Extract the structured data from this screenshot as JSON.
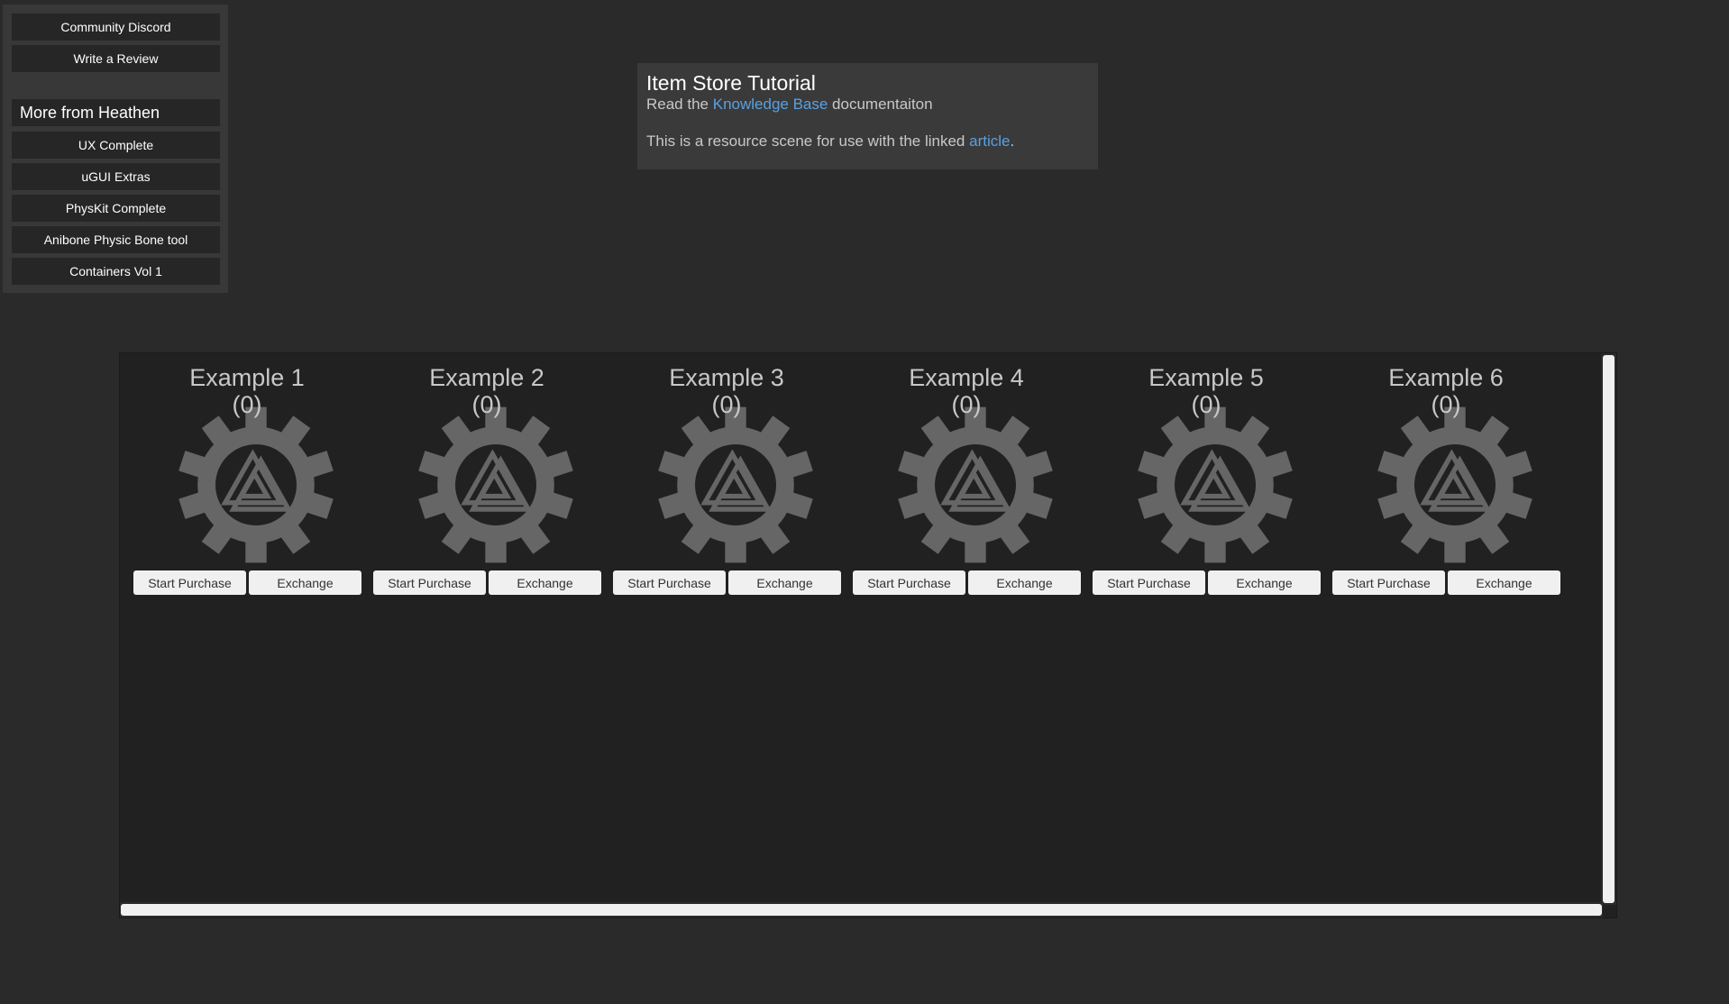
{
  "sidebar": {
    "top_buttons": [
      "Community Discord",
      "Write a Review"
    ],
    "header": "More from Heathen",
    "product_buttons": [
      "UX Complete",
      "uGUI Extras",
      "PhysKit Complete",
      "Anibone Physic Bone tool",
      "Containers Vol 1"
    ]
  },
  "info": {
    "title": "Item Store Tutorial",
    "line1_prefix": "Read the ",
    "line1_link": "Knowledge Base",
    "line1_suffix": " documentaiton",
    "line2_prefix": "This is a resource scene for use with the linked ",
    "line2_link": "article",
    "line2_suffix": "."
  },
  "items": [
    {
      "title": "Example 1",
      "count": "(0)",
      "purchase_label": "Start Purchase",
      "exchange_label": "Exchange"
    },
    {
      "title": "Example 2",
      "count": "(0)",
      "purchase_label": "Start Purchase",
      "exchange_label": "Exchange"
    },
    {
      "title": "Example 3",
      "count": "(0)",
      "purchase_label": "Start Purchase",
      "exchange_label": "Exchange"
    },
    {
      "title": "Example 4",
      "count": "(0)",
      "purchase_label": "Start Purchase",
      "exchange_label": "Exchange"
    },
    {
      "title": "Example 5",
      "count": "(0)",
      "purchase_label": "Start Purchase",
      "exchange_label": "Exchange"
    },
    {
      "title": "Example 6",
      "count": "(0)",
      "purchase_label": "Start Purchase",
      "exchange_label": "Exchange"
    }
  ],
  "colors": {
    "background": "#2a2a2a",
    "panel": "#383838",
    "button_dark": "#262626",
    "link": "#5aa0e0",
    "gear": "#666666",
    "light_button": "#f0f0f0"
  },
  "icons": {
    "item_icon": "gear-triangle-icon"
  }
}
